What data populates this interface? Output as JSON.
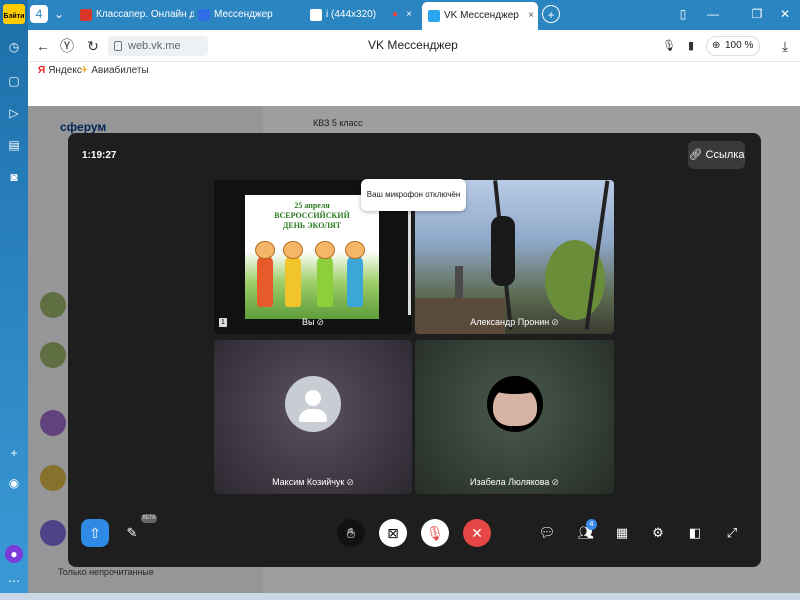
{
  "browser": {
    "logo_badge": "Бэйти",
    "tabs": [
      {
        "label": "Классапер. Онлайн доска",
        "active": false,
        "fav_color": "#d9362b"
      },
      {
        "label": "Мессенджер",
        "active": false,
        "fav_color": "#2e6de6"
      },
      {
        "label": "i (444x320)",
        "active": false,
        "fav_color": "#ffffff"
      },
      {
        "label": "VK Мессенджер",
        "active": true,
        "fav_color": "#2aa6f0"
      }
    ],
    "tab_close": "×",
    "new_tab": "+",
    "url": "web.vk.me",
    "page_title": "VK Мессенджер",
    "zoom": "100 %",
    "bookmarks": [
      {
        "icon": "Я",
        "label": "Яндекс",
        "icon_color": "#e52620"
      },
      {
        "icon": "✈",
        "label": "Авиабилеты",
        "icon_color": "#f2a516"
      }
    ]
  },
  "background": {
    "brand": "сферум",
    "chat_title": "КВЗ 5 класс",
    "unread_filter": "Только непрочитанные"
  },
  "call": {
    "timer": "1:19:27",
    "link_button": "Ссылка",
    "tooltip": "Ваш микрофон отключён",
    "participants": [
      {
        "name": "Вы",
        "mic_muted": true
      },
      {
        "name": "Александр Пронин",
        "mic_muted": true
      },
      {
        "name": "Максим Козийчук",
        "mic_muted": true
      },
      {
        "name": "Изабела Люлякова",
        "mic_muted": true
      }
    ],
    "poster": {
      "line1": "25 апреля",
      "line2": "ВСЕРОССИЙСКИЙ",
      "line3": "ДЕНЬ ЭКОЛЯТ"
    },
    "self_tile_badge": "1",
    "participants_badge": "4",
    "beta_badge": "BETA",
    "colors": {
      "accent": "#2f8ae5",
      "end_call": "#e64646",
      "modal": "#1e1e1e"
    }
  }
}
